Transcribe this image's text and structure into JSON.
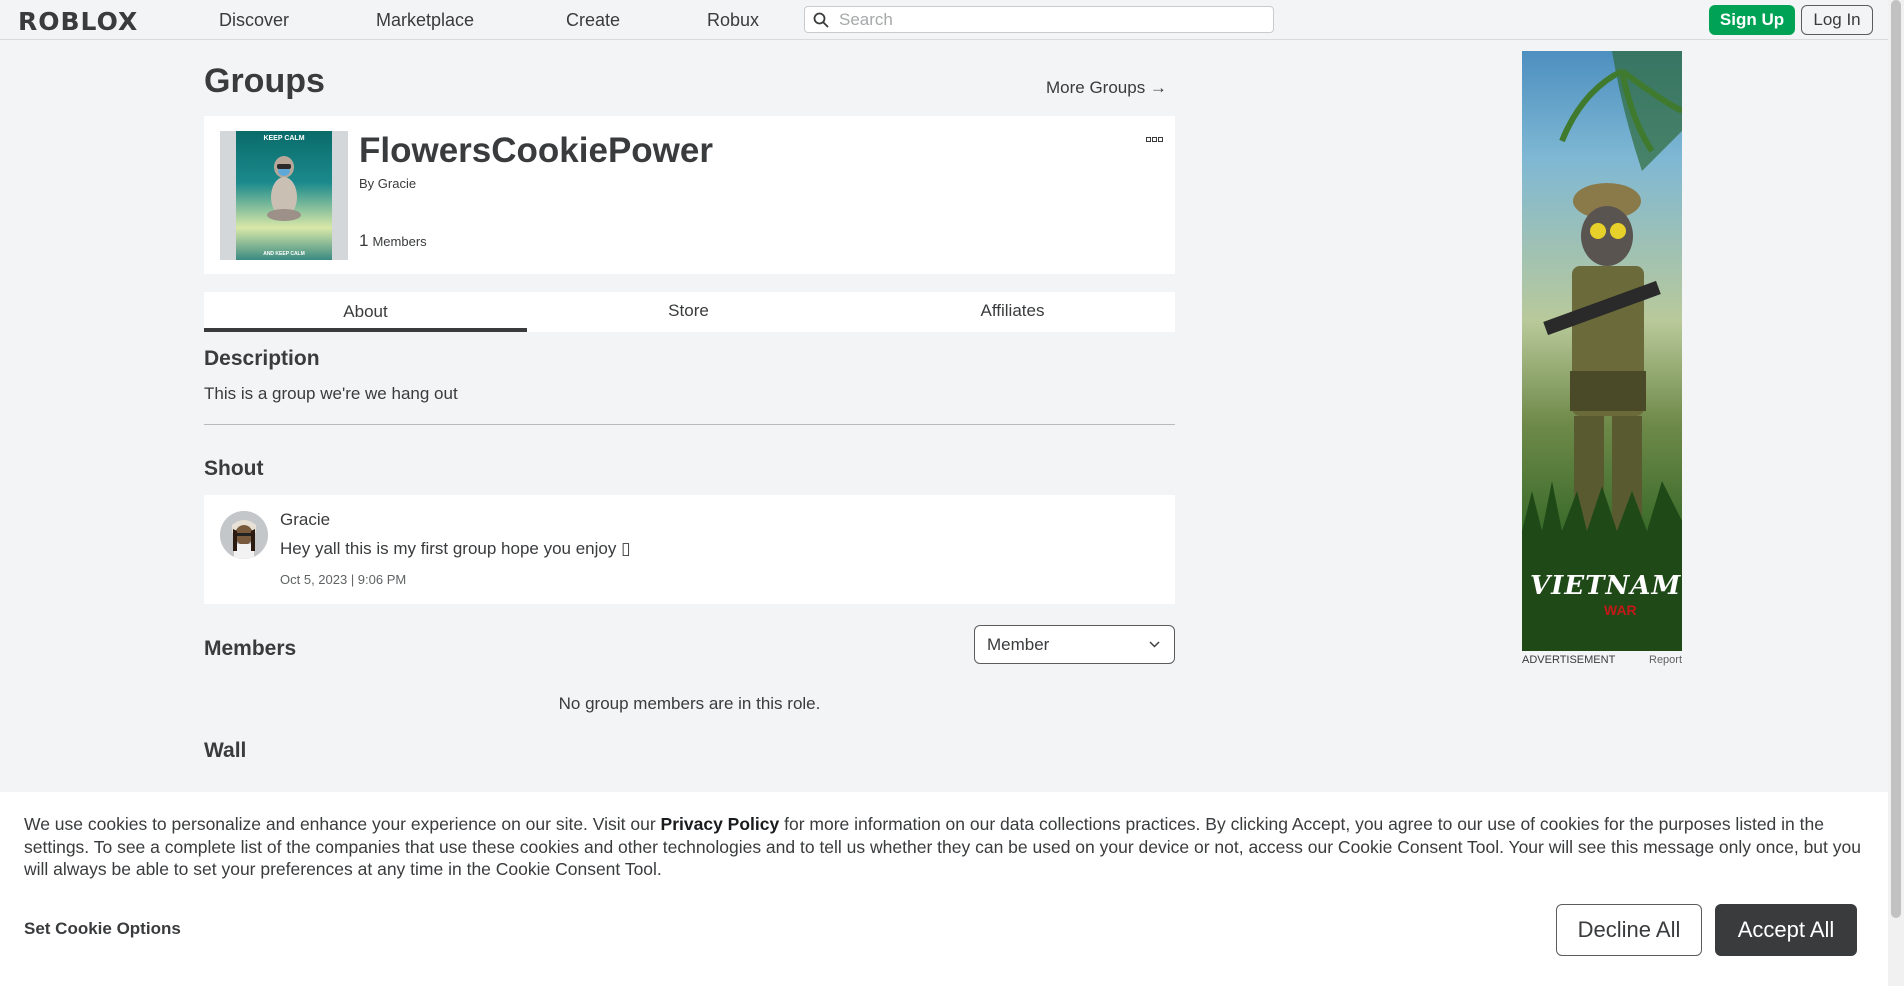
{
  "header": {
    "logo": "ROBLOX",
    "nav": [
      "Discover",
      "Marketplace",
      "Create",
      "Robux"
    ],
    "search_placeholder": "Search",
    "signup_label": "Sign Up",
    "login_label": "Log In"
  },
  "page": {
    "title": "Groups",
    "more_groups": "More Groups →"
  },
  "group": {
    "name": "FlowersCookiePower",
    "by_prefix": "By",
    "owner": "Gracie",
    "member_count": "1",
    "member_label": "Members",
    "thumb_top_text": "KEEP CALM",
    "thumb_bottom_text": "AND KEEP CALM"
  },
  "tabs": [
    "About",
    "Store",
    "Affiliates"
  ],
  "description": {
    "title": "Description",
    "text": "This is a group we're we hang out"
  },
  "shout": {
    "title": "Shout",
    "user": "Gracie",
    "text": "Hey yall this is my first group hope you enjoy ▯",
    "time": "Oct 5, 2023 | 9:06 PM"
  },
  "members": {
    "title": "Members",
    "role_selected": "Member",
    "empty_note": "No group members are in this role."
  },
  "wall": {
    "title": "Wall"
  },
  "ad": {
    "label": "ADVERTISEMENT",
    "report": "Report",
    "brand_text": "VIETNAM",
    "brand_sub": "WAR"
  },
  "cookie": {
    "text_before": "We use cookies to personalize and enhance your experience on our site. Visit our ",
    "privacy_link": "Privacy Policy",
    "text_after": " for more information on our data collections practices. By clicking Accept, you agree to our use of cookies for the purposes listed in the settings. To see a complete list of the companies that use these cookies and other technologies and to tell us whether they can be used on your device or not, access our Cookie Consent Tool. Your will see this message only once, but you will always be able to set your preferences at any time in the Cookie Consent Tool.",
    "options_label": "Set Cookie Options",
    "decline_label": "Decline All",
    "accept_label": "Accept All"
  },
  "colors": {
    "page_bg": "#f2f4f5",
    "signup_green": "#00a355",
    "text_dark": "#393b3d",
    "accept_bg": "#393b3d"
  }
}
